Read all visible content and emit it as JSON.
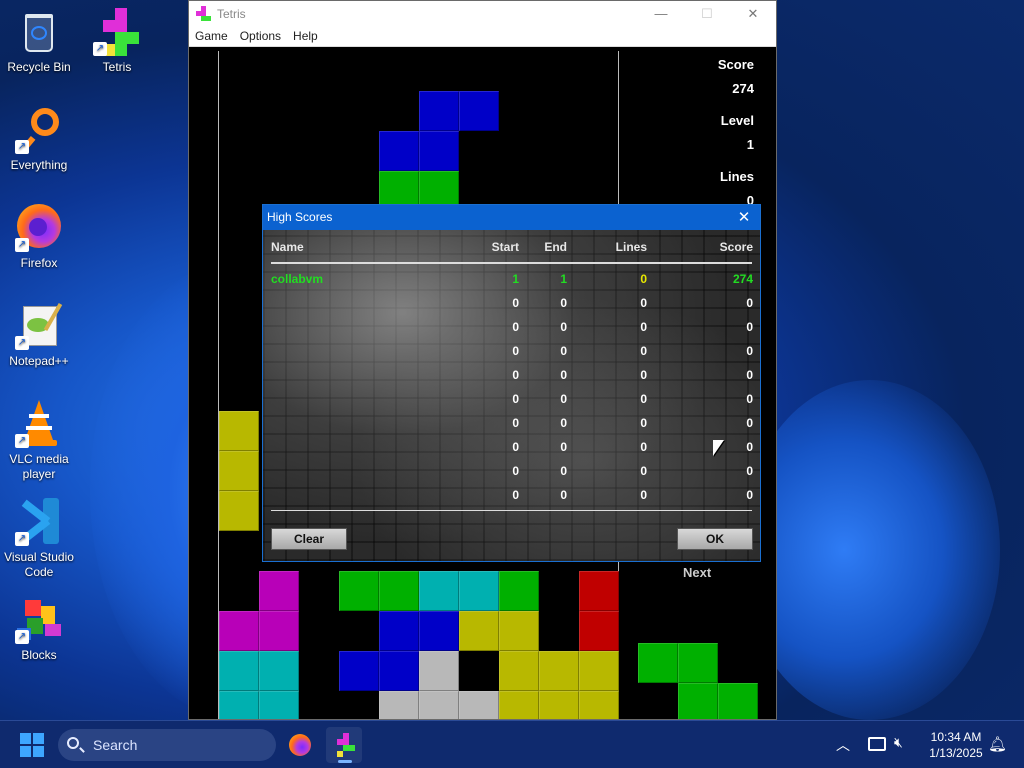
{
  "desktop": {
    "icons": [
      {
        "label": "Recycle Bin",
        "icon": "recycle-bin-icon"
      },
      {
        "label": "Tetris",
        "icon": "tetris-icon"
      },
      {
        "label": "Everything",
        "icon": "everything-search-icon"
      },
      {
        "label": "Firefox",
        "icon": "firefox-icon"
      },
      {
        "label": "Notepad++",
        "icon": "notepad-plus-plus-icon"
      },
      {
        "label": "VLC media player",
        "icon": "vlc-icon"
      },
      {
        "label": "Visual Studio Code",
        "icon": "vscode-icon"
      },
      {
        "label": "Blocks",
        "icon": "blocks-icon"
      }
    ]
  },
  "window": {
    "title": "Tetris",
    "menu": [
      "Game",
      "Options",
      "Help"
    ],
    "stats": {
      "score_label": "Score",
      "score_value": "274",
      "level_label": "Level",
      "level_value": "1",
      "lines_label": "Lines",
      "lines_value": "0"
    },
    "next_label": "Next"
  },
  "high_scores": {
    "title": "High Scores",
    "columns": {
      "name": "Name",
      "start": "Start",
      "end": "End",
      "lines": "Lines",
      "score": "Score"
    },
    "rows": [
      {
        "name": "collabvm",
        "start": "1",
        "end": "1",
        "lines": "0",
        "score": "274"
      },
      {
        "name": "",
        "start": "0",
        "end": "0",
        "lines": "0",
        "score": "0"
      },
      {
        "name": "",
        "start": "0",
        "end": "0",
        "lines": "0",
        "score": "0"
      },
      {
        "name": "",
        "start": "0",
        "end": "0",
        "lines": "0",
        "score": "0"
      },
      {
        "name": "",
        "start": "0",
        "end": "0",
        "lines": "0",
        "score": "0"
      },
      {
        "name": "",
        "start": "0",
        "end": "0",
        "lines": "0",
        "score": "0"
      },
      {
        "name": "",
        "start": "0",
        "end": "0",
        "lines": "0",
        "score": "0"
      },
      {
        "name": "",
        "start": "0",
        "end": "0",
        "lines": "0",
        "score": "0"
      },
      {
        "name": "",
        "start": "0",
        "end": "0",
        "lines": "0",
        "score": "0"
      },
      {
        "name": "",
        "start": "0",
        "end": "0",
        "lines": "0",
        "score": "0"
      }
    ],
    "clear_label": "Clear",
    "ok_label": "OK",
    "colors": {
      "highlight_name": "#22dd22",
      "highlight_lines": "#e8e800",
      "normal": "#ffffff"
    }
  },
  "taskbar": {
    "search_placeholder": "Search",
    "time": "10:34 AM",
    "date": "1/13/2025"
  },
  "colors": {
    "blue": "#0000c8",
    "green": "#00b000",
    "yellow": "#b8b800",
    "magenta": "#b800b8",
    "cyan": "#00b0b0",
    "red": "#c00000",
    "gray": "#b8b8b8"
  }
}
